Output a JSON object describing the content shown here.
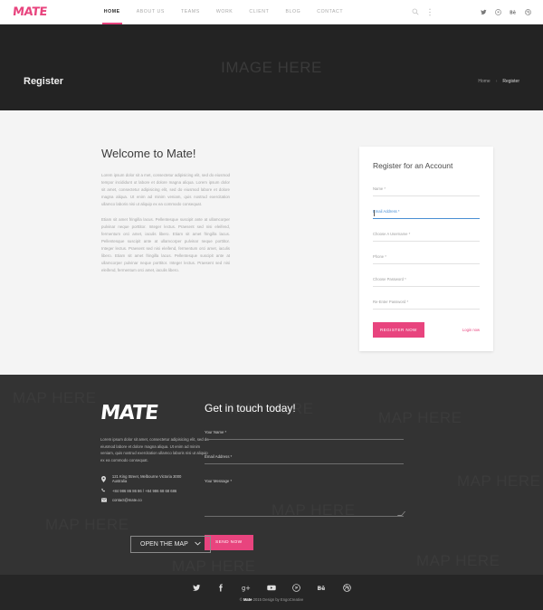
{
  "header": {
    "logo": "MATE",
    "nav": [
      {
        "label": "HOME",
        "active": true
      },
      {
        "label": "ABOUT US",
        "active": false
      },
      {
        "label": "TEAMS",
        "active": false
      },
      {
        "label": "WORK",
        "active": false
      },
      {
        "label": "CLIENT",
        "active": false
      },
      {
        "label": "BLOG",
        "active": false
      },
      {
        "label": "CONTACT",
        "active": false
      }
    ],
    "icons": [
      "search-icon",
      "more-vertical-icon"
    ],
    "social": [
      "twitter-icon",
      "pinterest-icon",
      "behance-icon",
      "dribbble-icon"
    ]
  },
  "banner": {
    "watermark": "IMAGE HERE",
    "title": "Register",
    "breadcrumb": {
      "home": "Home",
      "separator": "›",
      "current": "Register"
    }
  },
  "welcome": {
    "title": "Welcome to Mate!",
    "paragraph1": "Lorem ipsum dolor sit a met, consectetur adipisicing elit, sed do eiusmod tempor incididunt ut labore et dolore magna aliqua. Lorem ipsum dolor sit amet, consectetur adipisicing elit, sed do eiusmod labore et dolore magna aliqua. Ut enim ad minim veniam, quis nostrud exercitation ullamco laboris nisi ut aliquip ex ea commodo consequat.",
    "paragraph2": "Etiam sit amet fringilla lacus. Pellentesque suscipit ante at ullamcorper pulvinar neque porttitor. Integer lectus. Praesent sed nisi eleifend, fermentum orci amet, iaculis libero. Etiam sit amet fringilla lacus. Pellentesque suscipit ante at ullamcorper pulvinar neque porttitor. Integer lectus. Praesent sed nisi eleifend, fermentum orci amet, iaculis libero. Etiam sit amet fringilla lacus. Pellentesque suscipit ante at ullamcorper pulvinar neque porttitor. Integer lectus. Praesent sed nisi eleifend, fermentum orci amet, iaculis libero."
  },
  "register_card": {
    "title": "Register for an Account",
    "fields": [
      {
        "label": "Name *",
        "value": "",
        "focused": false
      },
      {
        "label": "Email Address *",
        "value": "",
        "focused": true
      },
      {
        "label": "Choose A Username *",
        "value": "",
        "focused": false
      },
      {
        "label": "Phone *",
        "value": "",
        "focused": false
      },
      {
        "label": "Choose Password *",
        "value": "",
        "focused": false
      },
      {
        "label": "Re-Enter Password *",
        "value": "",
        "focused": false
      }
    ],
    "submit_label": "REGISTER NOW",
    "login_link": "Login now"
  },
  "contact": {
    "watermark": "MAP HERE",
    "logo": "MATE",
    "paragraph": "Lorem ipsum dolor sit amet, consectetur adipisicing elit, sed do eiusmod labore et dolore magna aliqua. Ut enim ad minim veniam, quis nostrud exercitation ullamco laboris nisi ut aliquip ex ea commodo consequat.",
    "address": "121 King Street, Melbourne Victoria 3000 Australia",
    "phone": "+84 986 86 86 86 / +84 986 68 68 686",
    "email": "contact@mate.co",
    "map_button": "OPEN THE MAP",
    "form_title": "Get in touch today!",
    "fields": [
      {
        "label": "Your Name *",
        "value": ""
      },
      {
        "label": "Email Address *",
        "value": ""
      },
      {
        "label": "Your Message *",
        "value": ""
      }
    ],
    "submit_label": "SEND NOW"
  },
  "footer": {
    "social": [
      "twitter-icon",
      "facebook-icon",
      "google-plus-icon",
      "youtube-icon",
      "pinterest-icon",
      "behance-icon",
      "dribbble-icon"
    ],
    "copyright_pre": "© ",
    "copyright_brand": "Mate",
    "copyright_post": " 2015 Design by EngoCreative"
  },
  "colors": {
    "accent": "#e8447e",
    "dark": "#232323",
    "contact_bg": "#333333",
    "footer_bg": "#262626",
    "focus_blue": "#4a8fd4"
  }
}
